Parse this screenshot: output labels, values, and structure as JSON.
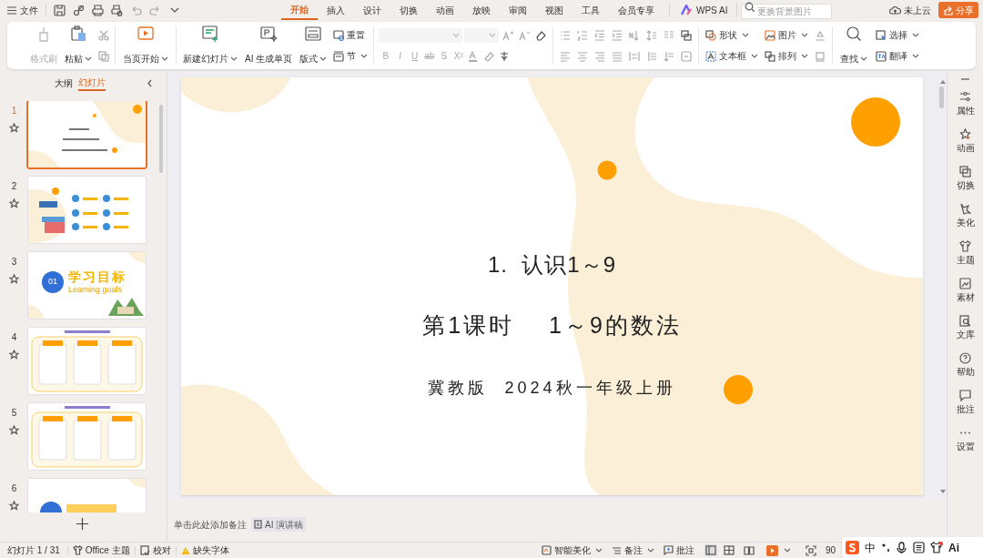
{
  "title_bar": {
    "file_menu": "文件",
    "tabs": [
      {
        "label": "开始",
        "selected": true
      },
      {
        "label": "插入",
        "selected": false
      },
      {
        "label": "设计",
        "selected": false
      },
      {
        "label": "切换",
        "selected": false
      },
      {
        "label": "动画",
        "selected": false
      },
      {
        "label": "放映",
        "selected": false
      },
      {
        "label": "审阅",
        "selected": false
      },
      {
        "label": "视图",
        "selected": false
      },
      {
        "label": "工具",
        "selected": false
      },
      {
        "label": "会员专享",
        "selected": false
      }
    ],
    "ai_button": "WPS AI",
    "search": {
      "placeholder": "更换背景图片"
    },
    "cloud": "未上云",
    "share": "分享"
  },
  "ribbon": {
    "clipboard": {
      "format_painter": {
        "label": "格式刷",
        "disabled": true
      },
      "paste": {
        "label": "粘贴"
      }
    },
    "slideshow": {
      "label": "当页开始"
    },
    "slides": {
      "new_slide": "新建幻灯片",
      "ai_page": "AI 生成单页",
      "layout": "版式",
      "reset": "重置",
      "section": "节"
    },
    "font": {
      "disabled": true,
      "format_buttons": [
        "B",
        "I",
        "U",
        "ab",
        "S",
        "X²"
      ]
    },
    "insert": {
      "shape": "形状",
      "picture": "图片",
      "textbox": "文本框",
      "arrange": "排列"
    },
    "editing": {
      "find": "查找",
      "select": "选择",
      "translate": "翻译"
    }
  },
  "slide_panel": {
    "tabs": [
      {
        "label": "大纲",
        "selected": false
      },
      {
        "label": "幻灯片",
        "selected": true
      }
    ],
    "slides": [
      {
        "number": "1",
        "selected": true,
        "kind": "cover"
      },
      {
        "number": "2",
        "selected": false,
        "kind": "contents"
      },
      {
        "number": "3",
        "selected": false,
        "kind": "section",
        "badge": "01",
        "title": "学习目标",
        "subtitle": "Learning goals"
      },
      {
        "number": "4",
        "selected": false,
        "kind": "cards"
      },
      {
        "number": "5",
        "selected": false,
        "kind": "cards"
      },
      {
        "number": "6",
        "selected": false,
        "kind": "partial"
      }
    ]
  },
  "slide": {
    "lines": [
      "1.  认识1～9",
      "第1课时　 1～9的数法",
      "冀教版  2024秋一年级上册"
    ]
  },
  "notes": {
    "placeholder": "单击此处添加备注",
    "ai_button": "AI 演讲稿"
  },
  "right_sidebar": [
    "属性",
    "动画",
    "切换",
    "美化",
    "主题",
    "素材",
    "文库",
    "帮助",
    "批注",
    "设置"
  ],
  "status_bar": {
    "slide_count": "幻灯片 1 / 31",
    "theme": "Office 主题",
    "proofing": "校对",
    "missing_fonts": "缺失字体",
    "beautify": "智能美化",
    "notes": "备注",
    "comments": "批注",
    "zoom": "90"
  },
  "ime_toolbar": {
    "mode": "中",
    "ai": "Ai"
  }
}
